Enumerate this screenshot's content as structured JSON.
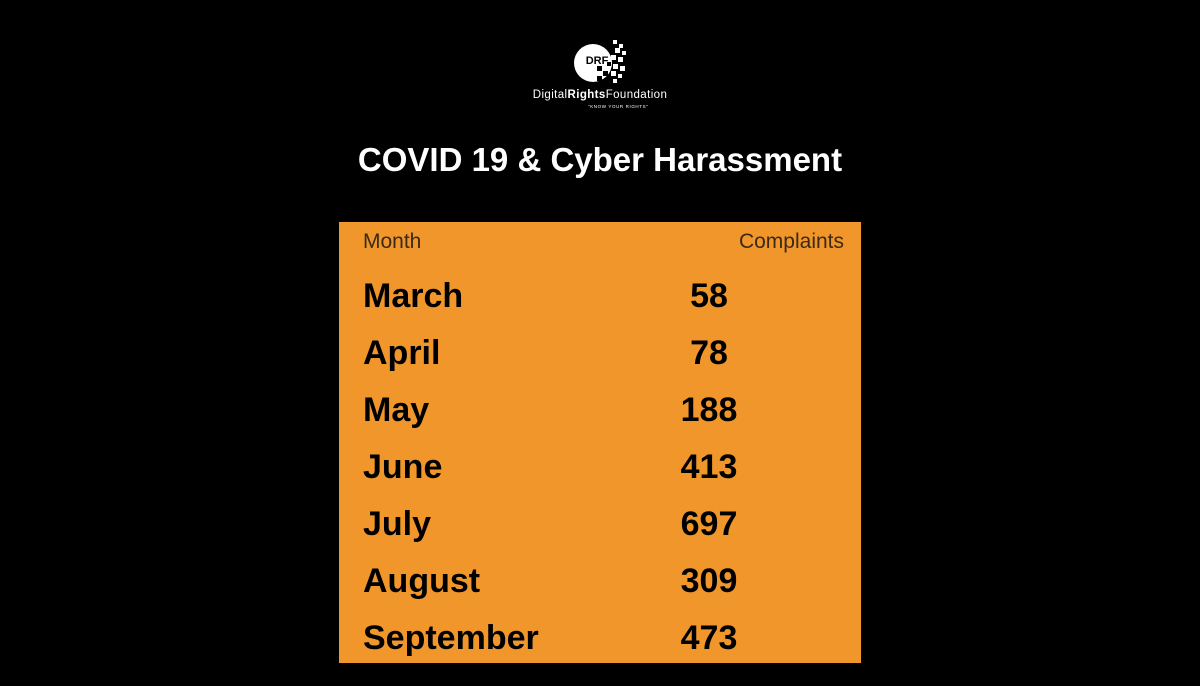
{
  "logo": {
    "mark_text": "DRF",
    "name_part1": "Digital",
    "name_part2": "Rights",
    "name_part3": "Foundation",
    "tagline": "\"KNOW YOUR RIGHTS\""
  },
  "title": "COVID 19 & Cyber Harassment",
  "colors": {
    "background": "#000000",
    "panel": "#f0962b",
    "text_light": "#ffffff",
    "text_dark": "#000000"
  },
  "chart_data": {
    "type": "table",
    "title": "COVID 19 & Cyber Harassment",
    "columns": [
      "Month",
      "Complaints"
    ],
    "rows": [
      {
        "month": "March",
        "complaints": 58
      },
      {
        "month": "April",
        "complaints": 78
      },
      {
        "month": "May",
        "complaints": 188
      },
      {
        "month": "June",
        "complaints": 413
      },
      {
        "month": "July",
        "complaints": 697
      },
      {
        "month": "August",
        "complaints": 309
      },
      {
        "month": "September",
        "complaints": 473
      }
    ]
  }
}
